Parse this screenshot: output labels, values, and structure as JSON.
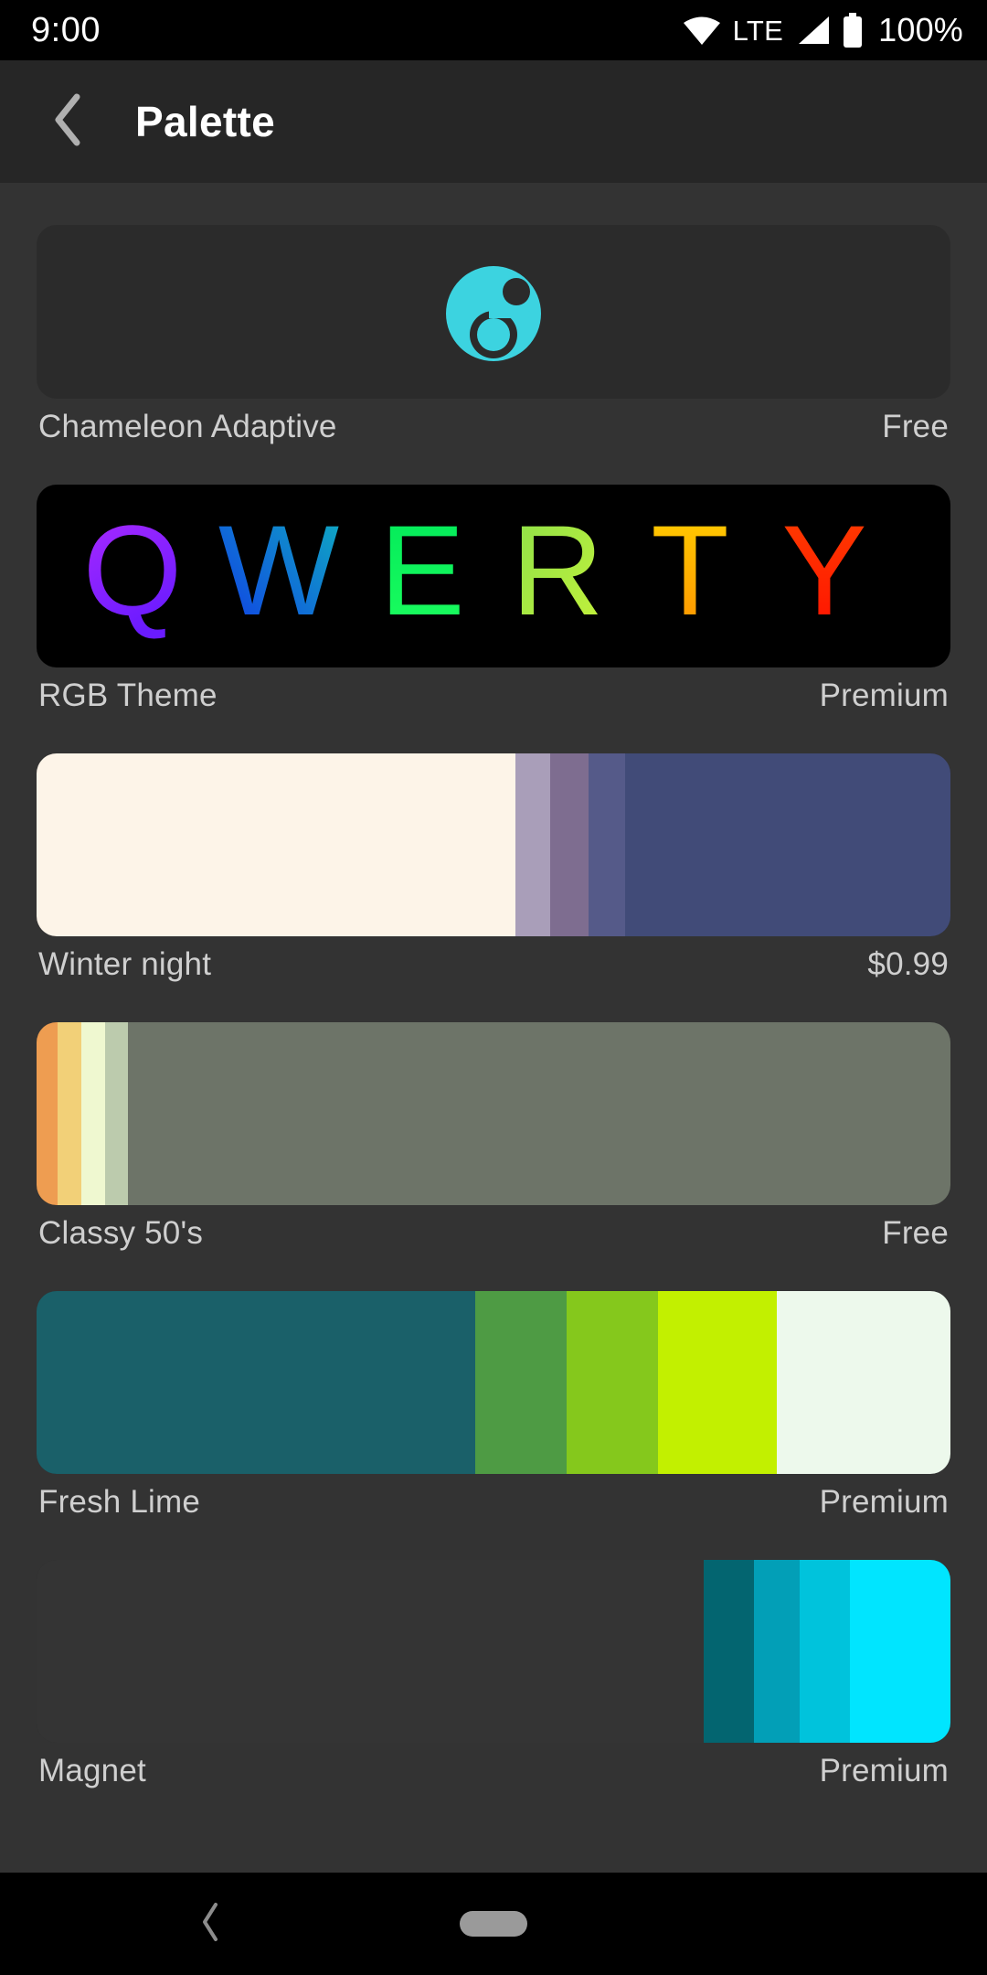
{
  "status_bar": {
    "clock": "9:00",
    "network_label": "LTE",
    "battery_label": "100%",
    "icons": [
      "wifi-icon",
      "signal-icon",
      "battery-icon"
    ]
  },
  "app_bar": {
    "title": "Palette",
    "back_icon": "chevron-left-icon"
  },
  "palettes": [
    {
      "name": "Chameleon Adaptive",
      "price": "Free",
      "preview_type": "logo",
      "logo_icon": "chameleon-logo-icon",
      "logo_color": "#3CD3E0",
      "card_background": "#2b2b2b"
    },
    {
      "name": "RGB Theme",
      "price": "Premium",
      "preview_type": "qwerty",
      "card_background": "#000000",
      "letters": [
        {
          "char": "Q",
          "from": "#B02BFF",
          "to": "#6A1BFF"
        },
        {
          "char": "W",
          "from": "#1038E8",
          "to": "#0FAFC0"
        },
        {
          "char": "E",
          "from": "#00E85A",
          "to": "#1DFF5E"
        },
        {
          "char": "R",
          "from": "#8BE04A",
          "to": "#C6F23A"
        },
        {
          "char": "T",
          "from": "#FFD200",
          "to": "#FF9000"
        },
        {
          "char": "Y",
          "from": "#FF4000",
          "to": "#FF1000"
        }
      ]
    },
    {
      "name": "Winter night",
      "price": "$0.99",
      "preview_type": "strips",
      "colors": [
        "#FDF4E8",
        "#A99EB9",
        "#7E6D90",
        "#555A89",
        "#414B78"
      ],
      "weights": [
        52.4,
        3.8,
        4.2,
        4.0,
        35.6
      ]
    },
    {
      "name": "Classy 50's",
      "price": "Free",
      "preview_type": "strips",
      "colors": [
        "#EE9D51",
        "#F2D078",
        "#EFF8D0",
        "#BCCBAD",
        "#6D7468"
      ],
      "weights": [
        2.3,
        2.6,
        2.6,
        2.5,
        90.0
      ]
    },
    {
      "name": "Fresh Lime",
      "price": "Premium",
      "preview_type": "strips",
      "colors": [
        "#1A6069",
        "#4E9B44",
        "#85C81C",
        "#C2F000",
        "#EDF9EC"
      ],
      "weights": [
        48.0,
        10.0,
        10.0,
        13.0,
        19.0
      ]
    },
    {
      "name": "Magnet",
      "price": "Premium",
      "preview_type": "strips",
      "colors": [
        "#343434",
        "#036570",
        "#029FB7",
        "#00C3DC",
        "#00E5FF"
      ],
      "weights": [
        73.0,
        5.5,
        5.0,
        5.5,
        11.0
      ]
    }
  ],
  "nav_bar": {
    "back_icon": "chevron-left-icon",
    "home_pill": "home-pill-handle"
  }
}
